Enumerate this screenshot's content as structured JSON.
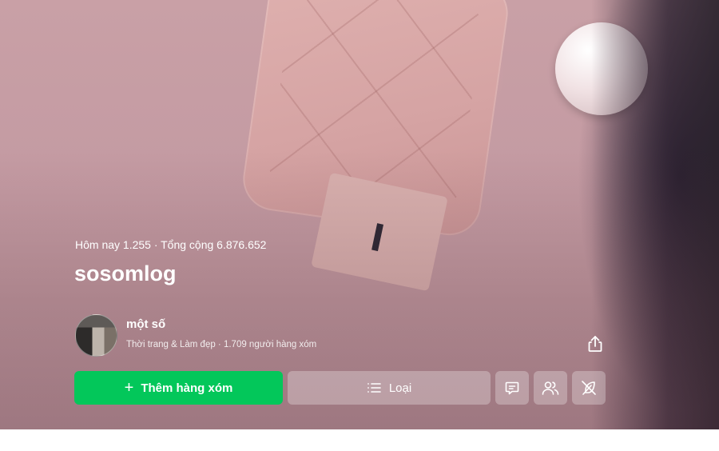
{
  "blog": {
    "stats": "Hôm nay 1.255 · Tổng cộng 6.876.652",
    "title": "sosomlog"
  },
  "category": {
    "name": "một số",
    "meta": "Thời trang & Làm đẹp · 1.709 người hàng xóm"
  },
  "actions": {
    "add_neighbor_label": "Thêm hàng xóm",
    "category_label": "Loại"
  },
  "colors": {
    "accent": "#03c75a"
  }
}
